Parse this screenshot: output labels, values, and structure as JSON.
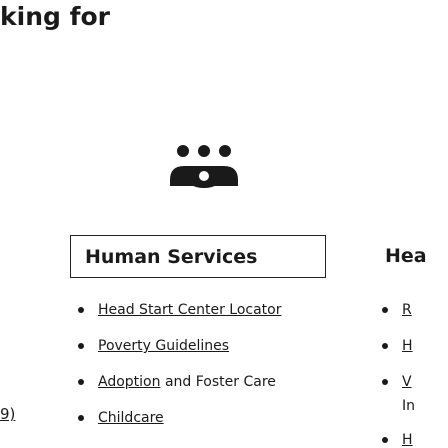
{
  "header": {
    "heading_fragment": "king for"
  },
  "left_column": {
    "fragment": "9)"
  },
  "human_services": {
    "icon": "family-people-icon",
    "title": "Human Services",
    "links": [
      {
        "label": "Head Start Center Locator"
      },
      {
        "label": "Poverty Guidelines"
      },
      {
        "label_link": "Adoption",
        "label_text": " and Foster Care"
      },
      {
        "label": "Childcare"
      }
    ]
  },
  "right_column": {
    "heading_fragment": "Hea",
    "items": [
      {
        "label": "R"
      },
      {
        "label": "H"
      },
      {
        "label": "V",
        "sub": "In"
      },
      {
        "label": "H"
      }
    ]
  },
  "colors": {
    "text": "#1a1a1a",
    "border": "#222222",
    "background": "#ffffff"
  }
}
